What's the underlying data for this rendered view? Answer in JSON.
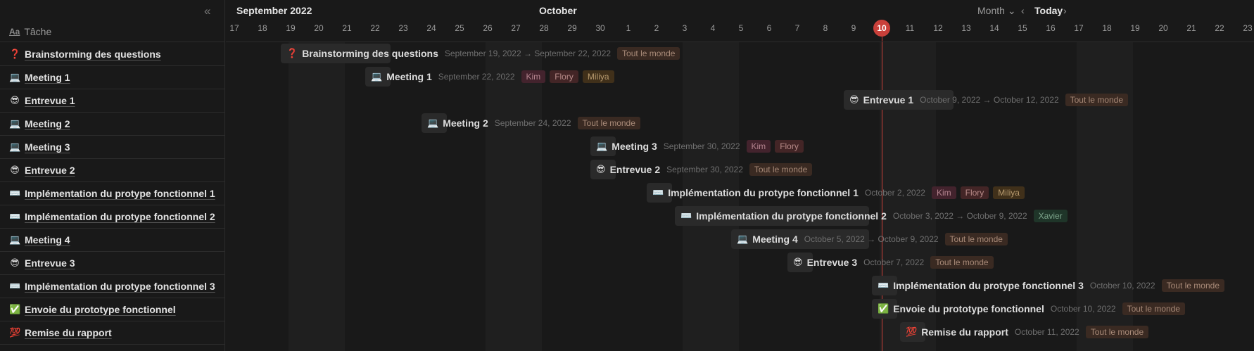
{
  "sidebar": {
    "collapse_icon": "double-chevron-left-icon",
    "header": {
      "prop_icon": "Aa",
      "label": "Tâche"
    },
    "rows": [
      {
        "icon": "❓",
        "label": "Brainstorming des questions"
      },
      {
        "icon": "💻",
        "label": "Meeting 1"
      },
      {
        "icon": "😎",
        "label": "Entrevue 1"
      },
      {
        "icon": "💻",
        "label": "Meeting 2"
      },
      {
        "icon": "💻",
        "label": "Meeting 3"
      },
      {
        "icon": "😎",
        "label": "Entrevue 2"
      },
      {
        "icon": "⌨️",
        "label": "Implémentation du protype fonctionnel 1"
      },
      {
        "icon": "⌨️",
        "label": "Implémentation du protype fonctionnel 2"
      },
      {
        "icon": "💻",
        "label": "Meeting 4"
      },
      {
        "icon": "😎",
        "label": "Entrevue 3"
      },
      {
        "icon": "⌨️",
        "label": "Implémentation du protype fonctionnel 3"
      },
      {
        "icon": "✅",
        "label": "Envoie du prototype fonctionnel"
      },
      {
        "icon": "💯",
        "label": "Remise du rapport"
      }
    ]
  },
  "timeline": {
    "months": [
      "September 2022",
      "October"
    ],
    "view_select": "Month",
    "prev_icon": "chevron-left-icon",
    "next_icon": "chevron-right-icon",
    "today_label": "Today",
    "days": [
      "17",
      "18",
      "19",
      "20",
      "21",
      "22",
      "23",
      "24",
      "25",
      "26",
      "27",
      "28",
      "29",
      "30",
      "1",
      "2",
      "3",
      "4",
      "5",
      "6",
      "7",
      "8",
      "9",
      "10",
      "11",
      "12",
      "13",
      "14",
      "15",
      "16",
      "17",
      "18",
      "19",
      "20",
      "21",
      "22",
      "23"
    ],
    "today": "10",
    "tasks": [
      {
        "icon": "❓",
        "name": "Brainstorming des questions",
        "date": "September 19, 2022 → September 22, 2022",
        "tags": [
          {
            "label": "Tout le monde",
            "color": "brown"
          }
        ]
      },
      {
        "icon": "💻",
        "name": "Meeting 1",
        "date": "September 22, 2022",
        "tags": [
          {
            "label": "Kim",
            "color": "kim"
          },
          {
            "label": "Flory",
            "color": "flory"
          },
          {
            "label": "Miliya",
            "color": "miliya"
          }
        ]
      },
      {
        "icon": "😎",
        "name": "Entrevue 1",
        "date": "October 9, 2022 → October 12, 2022",
        "tags": [
          {
            "label": "Tout le monde",
            "color": "brown"
          }
        ]
      },
      {
        "icon": "💻",
        "name": "Meeting 2",
        "date": "September 24, 2022",
        "tags": [
          {
            "label": "Tout le monde",
            "color": "brown"
          }
        ]
      },
      {
        "icon": "💻",
        "name": "Meeting 3",
        "date": "September 30, 2022",
        "tags": [
          {
            "label": "Kim",
            "color": "kim"
          },
          {
            "label": "Flory",
            "color": "flory"
          }
        ]
      },
      {
        "icon": "😎",
        "name": "Entrevue 2",
        "date": "September 30, 2022",
        "tags": [
          {
            "label": "Tout le monde",
            "color": "brown"
          }
        ]
      },
      {
        "icon": "⌨️",
        "name": "Implémentation du protype fonctionnel 1",
        "date": "October 2, 2022",
        "tags": [
          {
            "label": "Kim",
            "color": "kim"
          },
          {
            "label": "Flory",
            "color": "flory"
          },
          {
            "label": "Miliya",
            "color": "miliya"
          }
        ]
      },
      {
        "icon": "⌨️",
        "name": "Implémentation du protype fonctionnel 2",
        "date": "October 3, 2022 → October 9, 2022",
        "tags": [
          {
            "label": "Xavier",
            "color": "green"
          }
        ]
      },
      {
        "icon": "💻",
        "name": "Meeting 4",
        "date": "October 5, 2022 → October 9, 2022",
        "tags": [
          {
            "label": "Tout le monde",
            "color": "brown"
          }
        ]
      },
      {
        "icon": "😎",
        "name": "Entrevue 3",
        "date": "October 7, 2022",
        "tags": [
          {
            "label": "Tout le monde",
            "color": "brown"
          }
        ]
      },
      {
        "icon": "⌨️",
        "name": "Implémentation du protype fonctionnel 3",
        "date": "October 10, 2022",
        "tags": [
          {
            "label": "Tout le monde",
            "color": "brown"
          }
        ]
      },
      {
        "icon": "✅",
        "name": "Envoie du prototype fonctionnel",
        "date": "October 10, 2022",
        "tags": [
          {
            "label": "Tout le monde",
            "color": "brown"
          }
        ]
      },
      {
        "icon": "💯",
        "name": "Remise du rapport",
        "date": "October 11, 2022",
        "tags": [
          {
            "label": "Tout le monde",
            "color": "brown"
          }
        ]
      }
    ]
  },
  "colors": {
    "accent_today": "#c9403a",
    "background": "#191919",
    "weekend_shade": "#1f1f1f"
  }
}
